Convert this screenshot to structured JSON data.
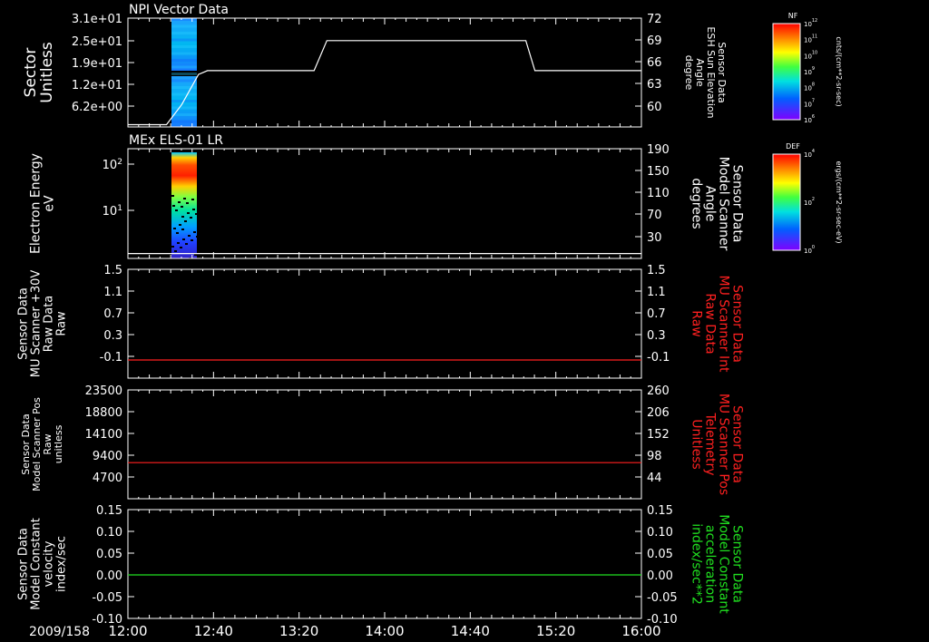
{
  "date_label": "2009/158",
  "time_ticks": [
    "12:00",
    "12:40",
    "13:20",
    "14:00",
    "14:40",
    "15:20",
    "16:00"
  ],
  "chart_data": [
    {
      "type": "heatmap",
      "title": "NPI Vector Data",
      "ylabel_left": [
        "Sector",
        "Unitless"
      ],
      "left_ticks": [
        "3.1e+01",
        "2.5e+01",
        "1.9e+01",
        "1.2e+01",
        "6.2e+00"
      ],
      "ylabel_right": [
        "Sensor Data",
        "ESH Sun Elevation",
        "Angle",
        "degree"
      ],
      "right_ticks": [
        "72",
        "69",
        "66",
        "63",
        "60"
      ],
      "right_ylim": [
        57.5,
        72
      ],
      "line_color": "#ffffff",
      "line_series": {
        "name": "ESH Sun Elevation Angle",
        "x_hours": [
          12.0,
          12.3,
          12.42,
          12.55,
          12.62,
          13.45,
          13.55,
          15.1,
          15.17,
          16.0
        ],
        "y": [
          57.8,
          57.8,
          60.5,
          64.5,
          65.0,
          65.0,
          69.0,
          69.0,
          65.0,
          65.0
        ]
      },
      "colorbar": {
        "label": "NF",
        "units": "cnts/(cm**2-sr-sec)",
        "ticks": [
          "10^12",
          "10^11",
          "10^10",
          "10^9",
          "10^8",
          "10^7",
          "10^6"
        ]
      }
    },
    {
      "type": "heatmap",
      "title": "MEx ELS-01 LR",
      "ylabel_left": [
        "Electron Energy",
        "eV"
      ],
      "left_ticks": [
        "10^2",
        "10^1"
      ],
      "ylabel_right": [
        "Sensor Data",
        "Model Scanner",
        "Angle",
        "degrees"
      ],
      "right_ticks": [
        "190",
        "150",
        "110",
        "70",
        "30"
      ],
      "right_ylim": [
        0,
        190
      ],
      "line_color": "#ffffff",
      "line_series": {
        "name": "Model Scanner Angle",
        "x_hours": [
          12.0,
          16.0
        ],
        "y": [
          8.5,
          8.5
        ]
      },
      "colorbar": {
        "label": "DEF",
        "units": "ergs/(cm**2-sr-sec-eV)",
        "ticks": [
          "10^4",
          "10^2",
          "10^0"
        ]
      }
    },
    {
      "type": "line",
      "ylabel_left": [
        "Sensor Data",
        "MU Scanner +30V",
        "Raw Data",
        "Raw"
      ],
      "left_ticks": [
        "1.5",
        "1.1",
        "0.7",
        "0.3",
        "-0.1"
      ],
      "left_ylim": [
        -0.3,
        1.5
      ],
      "ylabel_right": [
        "Sensor Data",
        "MU Scanner Int",
        "Raw Data",
        "Raw"
      ],
      "right_ticks": [
        "1.5",
        "1.1",
        "0.7",
        "0.3",
        "-0.1"
      ],
      "right_color": "#ff2020",
      "line_color": "#ff2020",
      "series": [
        {
          "x_hours": [
            12.0,
            16.0
          ],
          "y": [
            0.0,
            0.0
          ]
        }
      ]
    },
    {
      "type": "line",
      "ylabel_left": [
        "Sensor Data",
        "Model Scanner Pos",
        "Raw",
        "unitless"
      ],
      "left_ticks": [
        "23500",
        "18800",
        "14100",
        "9400",
        "4700"
      ],
      "left_ylim": [
        0,
        23500
      ],
      "ylabel_right": [
        "Sensor Data",
        "MU Scanner Pos",
        "Telemetry",
        "Unitless"
      ],
      "right_ticks": [
        "260",
        "206",
        "152",
        "98",
        "44"
      ],
      "right_color": "#ff2020",
      "line_color": "#ff2020",
      "series": [
        {
          "x_hours": [
            12.0,
            16.0
          ],
          "y": [
            7800,
            7800
          ]
        }
      ]
    },
    {
      "type": "line",
      "ylabel_left": [
        "Sensor Data",
        "Model Constant",
        "velocity",
        "index/sec"
      ],
      "left_ticks": [
        "0.15",
        "0.10",
        "0.05",
        "0.00",
        "-0.05",
        "-0.10"
      ],
      "left_ylim": [
        -0.1,
        0.15
      ],
      "ylabel_right": [
        "Sensor Data",
        "Model Constant",
        "acceleration",
        "index/sec**2"
      ],
      "right_ticks": [
        "0.15",
        "0.10",
        "0.05",
        "0.00",
        "-0.05",
        "-0.10"
      ],
      "right_color": "#20e020",
      "line_color": "#20e020",
      "series": [
        {
          "x_hours": [
            12.0,
            16.0
          ],
          "y": [
            0.0,
            0.0
          ]
        }
      ]
    }
  ]
}
